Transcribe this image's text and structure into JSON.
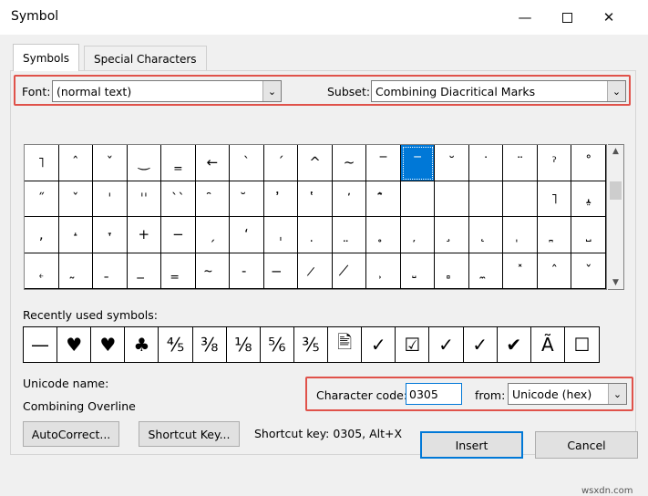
{
  "window": {
    "title": "Symbol"
  },
  "tabs": {
    "symbols": "Symbols",
    "special": "Special Characters"
  },
  "font": {
    "label": "Font:",
    "value": "(normal text)"
  },
  "subset": {
    "label": "Subset:",
    "value": "Combining Diacritical Marks"
  },
  "grid": {
    "cells": [
      "˥",
      "ˆ",
      "ˇ",
      "‿",
      "‗",
      "←",
      "`",
      "´",
      "^",
      "~",
      "‾",
      "‾",
      "˘",
      "˙",
      "¨",
      "ˀ",
      "˚",
      "˝",
      "ˇ",
      "ˈ",
      "ˈˈ",
      "``",
      "̑",
      "̆",
      "̓",
      "̔",
      "̕",
      "̂̃",
      "",
      "",
      "",
      "",
      "˥",
      "ﻴ",
      ",",
      "˔",
      "˕",
      "+",
      "−",
      "ˏ",
      "ʻ",
      "ˌ",
      "̣",
      "̤",
      "̥",
      "̦",
      "̧",
      "̨",
      "̩",
      "̪",
      "˽",
      "˿",
      "̰",
      "̱",
      "̲",
      "̳",
      "̴",
      "̵",
      "̶",
      "̷",
      "̸",
      "̹",
      "̺",
      "̻",
      "̼",
      "˟",
      "ˆ",
      "ˇ",
      "˗",
      "̴",
      "‒",
      "―",
      "═",
      "~",
      "-",
      "—",
      "/",
      "/",
      "˒",
      "˪",
      "˫",
      "ʭ",
      "ʰ"
    ],
    "selected_index": 11
  },
  "recent": {
    "label": "Recently used symbols:",
    "symbols": [
      "—",
      "♥",
      "♥",
      "♣",
      "⅘",
      "⅜",
      "⅛",
      "⅚",
      "⅗",
      "🖹",
      "✓",
      "☑",
      "✓",
      "✓",
      "✔",
      "Ã",
      "☐"
    ]
  },
  "unicode_name": {
    "label": "Unicode name:",
    "value": "Combining Overline"
  },
  "char_code": {
    "label": "Character code:",
    "value": "0305"
  },
  "from": {
    "label": "from:",
    "value": "Unicode (hex)"
  },
  "buttons": {
    "autocorrect": "AutoCorrect...",
    "shortcut_key": "Shortcut Key...",
    "insert": "Insert",
    "cancel": "Cancel"
  },
  "shortcut_text": "Shortcut key: 0305, Alt+X",
  "watermark": "wsxdn.com",
  "icons": {
    "minimize": "minimize-icon",
    "maximize": "maximize-icon",
    "close": "close-icon",
    "dropdown": "chevron-down-icon"
  },
  "colors": {
    "accent": "#0078d7",
    "highlight": "#e0524a"
  }
}
